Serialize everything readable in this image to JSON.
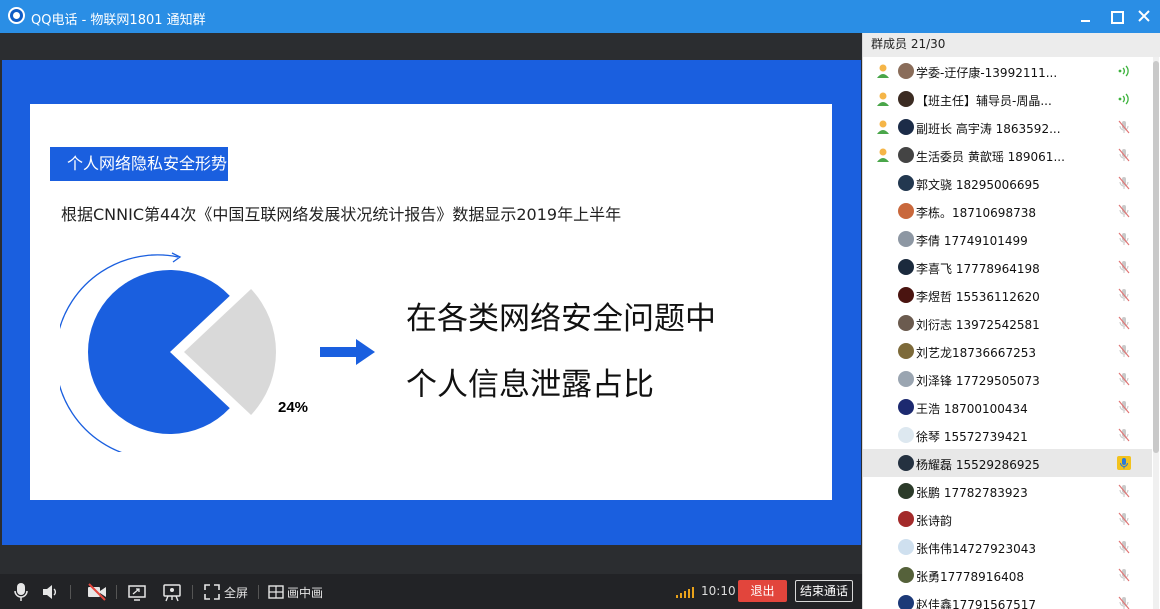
{
  "window": {
    "title": "QQ电话 - 物联网1801 通知群"
  },
  "slide": {
    "tag": "个人网络隐私安全形势",
    "subtitle": "根据CNNIC第44次《中国互联网络发展状况统计报告》数据显示2019年上半年",
    "pie_percent_value": 24,
    "pie_label": "24%",
    "headline_line1": "在各类网络安全问题中",
    "headline_line2": "个人信息泄露占比",
    "colors": {
      "blue": "#1a5fdf",
      "grey_slice": "#d9d9d9"
    }
  },
  "toolbar": {
    "fullscreen_label": "全屏",
    "pip_label": "画中画",
    "time": "10:10",
    "exit_label": "退出",
    "end_call_label": "结束通话"
  },
  "members": {
    "header": "群成员 21/30",
    "items": [
      {
        "name": "学委-迂仔康-13992111...",
        "role": true,
        "status": "speaking",
        "avatar": "#8a6d5a",
        "highlight": false
      },
      {
        "name": "【班主任】辅导员-周晶...",
        "role": true,
        "status": "speaking",
        "avatar": "#3b2b22",
        "highlight": false
      },
      {
        "name": "副班长 高宇涛 1863592...",
        "role": true,
        "status": "muted",
        "avatar": "#1c2c48",
        "highlight": false
      },
      {
        "name": "生活委员 黄歆瑶 189061...",
        "role": true,
        "status": "muted",
        "avatar": "#444444",
        "highlight": false
      },
      {
        "name": "郭文骁   18295006695",
        "role": false,
        "status": "muted",
        "avatar": "#233850",
        "highlight": false
      },
      {
        "name": "李栋。18710698738",
        "role": false,
        "status": "muted",
        "avatar": "#c9683c",
        "highlight": false
      },
      {
        "name": "李倩 17749101499",
        "role": false,
        "status": "muted",
        "avatar": "#8d97a3",
        "highlight": false
      },
      {
        "name": "李喜飞  17778964198",
        "role": false,
        "status": "muted",
        "avatar": "#1b2a3d",
        "highlight": false
      },
      {
        "name": "李煜哲 15536112620",
        "role": false,
        "status": "muted",
        "avatar": "#4a1410",
        "highlight": false
      },
      {
        "name": "刘衍志    13972542581",
        "role": false,
        "status": "muted",
        "avatar": "#6b5b4f",
        "highlight": false
      },
      {
        "name": "刘艺龙18736667253",
        "role": false,
        "status": "muted",
        "avatar": "#7d6a3a",
        "highlight": false
      },
      {
        "name": "刘泽锋 17729505073",
        "role": false,
        "status": "muted",
        "avatar": "#9aa5b1",
        "highlight": false
      },
      {
        "name": "王浩   18700100434",
        "role": false,
        "status": "muted",
        "avatar": "#1d2a70",
        "highlight": false
      },
      {
        "name": "徐琴 15572739421",
        "role": false,
        "status": "muted",
        "avatar": "#dde8f0",
        "highlight": false
      },
      {
        "name": "杨耀磊 15529286925",
        "role": false,
        "status": "mic",
        "avatar": "#243140",
        "highlight": true
      },
      {
        "name": "张鹏 17782783923",
        "role": false,
        "status": "muted",
        "avatar": "#2c3b2a",
        "highlight": false
      },
      {
        "name": "张诗韵",
        "role": false,
        "status": "muted",
        "avatar": "#a32a2a",
        "highlight": false
      },
      {
        "name": "张伟伟14727923043",
        "role": false,
        "status": "muted",
        "avatar": "#cfe0ef",
        "highlight": false
      },
      {
        "name": "张勇17778916408",
        "role": false,
        "status": "muted",
        "avatar": "#55613a",
        "highlight": false
      },
      {
        "name": "赵佳鑫17791567517",
        "role": false,
        "status": "muted",
        "avatar": "#1d3a78",
        "highlight": false
      }
    ]
  }
}
